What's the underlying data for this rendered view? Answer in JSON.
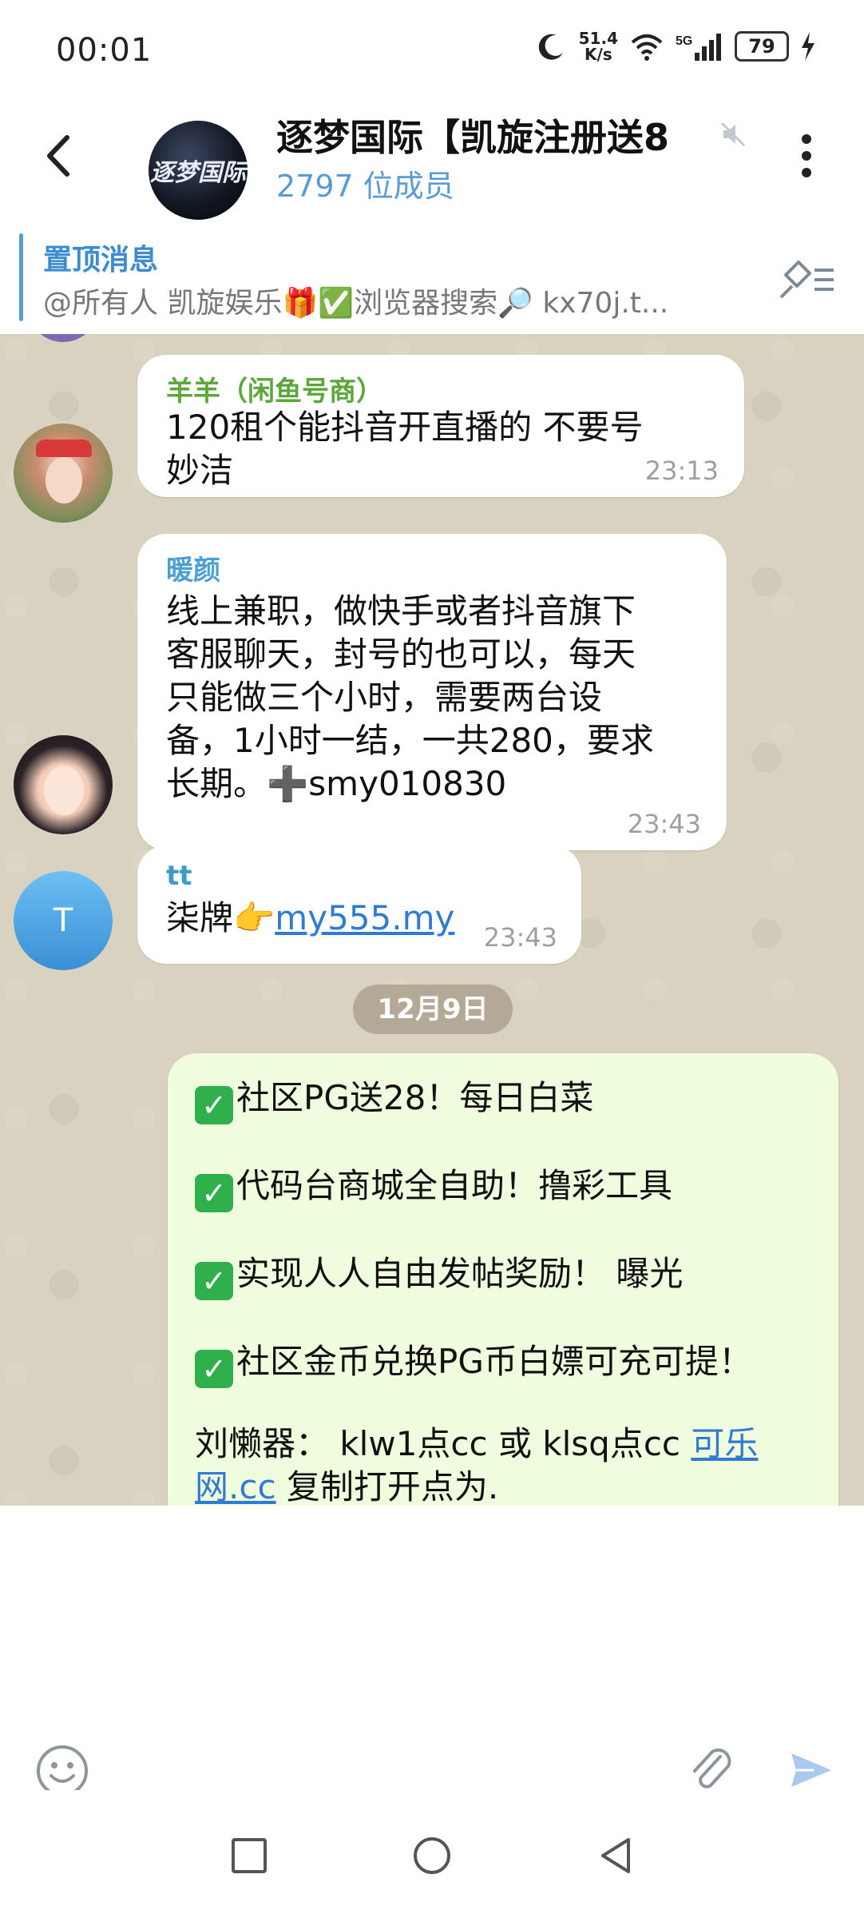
{
  "status_bar": {
    "time": "00:01",
    "net_speed_value": "51.4",
    "net_speed_unit": "K/s",
    "network": "5G",
    "battery": "79"
  },
  "header": {
    "group_title": "逐梦国际【凯旋注册送8",
    "members": "2797 位成员",
    "avatar_text": "逐梦国际"
  },
  "pinned": {
    "title": "置顶消息",
    "text": "@所有人 凯旋娱乐🎁✅浏览器搜索🔎 kx70j.t..."
  },
  "messages": [
    {
      "sender": "羊羊（闲鱼号商）",
      "sender_color": "#5ba73a",
      "lines": [
        "120租个能抖音开直播的 不要号",
        "妙洁"
      ],
      "time": "23:13"
    },
    {
      "sender": "暖颜",
      "sender_color": "#4a9fd6",
      "lines": [
        "线上兼职，做快手或者抖音旗下",
        "客服聊天，封号的也可以，每天",
        "只能做三个小时，需要两台设",
        "备，1小时一结，一共280，要求",
        "长期。➕smy010830"
      ],
      "time": "23:43"
    },
    {
      "sender": "tt",
      "sender_color": "#3e9bc7",
      "text_prefix": "柒牌👉",
      "link": "my555.my",
      "time": "23:43",
      "avatar_letter": "T"
    }
  ],
  "date_separator": "12月9日",
  "outgoing": {
    "lines": [
      "社区PG送28！每日白菜",
      "代码台商城全自助！撸彩工具",
      "实现人人自由发帖奖励！ 曝光",
      "社区金币兑换PG币白嫖可充可提！"
    ],
    "check": "✓",
    "liu_text": "刘懒器： klw1点cc 或 klsq点cc ",
    "liu_link1": "可乐",
    "liu_link2": "网.cc",
    "liu_tail": " 复制打开点为."
  },
  "colors": {
    "accent": "#5a9bd6",
    "chat_bg": "#d9d2c1",
    "outgoing_bubble": "#effdde",
    "link": "#2f7bd4"
  }
}
